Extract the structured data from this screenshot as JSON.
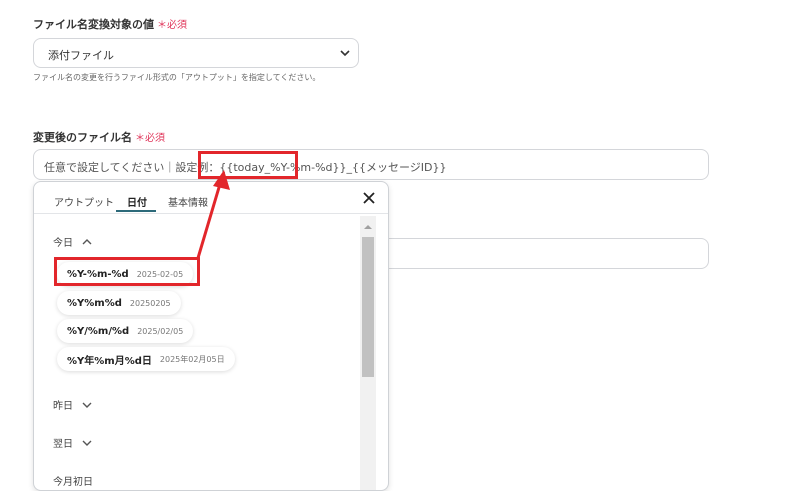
{
  "field1": {
    "label": "ファイル名変換対象の値",
    "required_mark": "＊必須",
    "selected": "添付ファイル",
    "help": "ファイル名の変更を行うファイル形式の「アウトプット」を指定してください。"
  },
  "field2": {
    "label": "変更後のファイル名",
    "required_mark": "＊必須",
    "prefix": "任意で設定してください｜設定例：",
    "highlight": "{{today_%Y-%m-%d}}",
    "suffix": "_{{メッセージID}}"
  },
  "panel": {
    "tabs": [
      "アウトプット",
      "日付",
      "基本情報"
    ],
    "active_tab": "日付",
    "sections": {
      "today": "今日",
      "yesterday": "昨日",
      "next_day": "翌日",
      "partial": "今月初日"
    },
    "formats": [
      {
        "fmt": "%Y-%m-%d",
        "example": "2025-02-05"
      },
      {
        "fmt": "%Y%m%d",
        "example": "20250205"
      },
      {
        "fmt": "%Y/%m/%d",
        "example": "2025/02/05"
      },
      {
        "fmt": "%Y年%m月%d日",
        "example": "2025年02月05日"
      }
    ]
  },
  "colors": {
    "annotation_red": "#e2262b",
    "required_pink": "#e0355a",
    "tab_accent": "#2d6a7a"
  }
}
